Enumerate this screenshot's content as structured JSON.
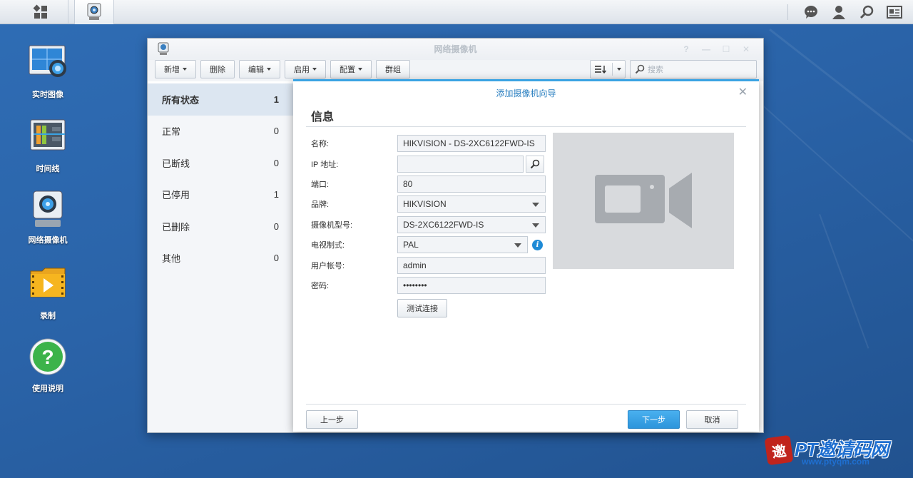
{
  "desktop": {
    "icons": [
      {
        "label": "实时图像",
        "icon": "live-view-icon"
      },
      {
        "label": "时间线",
        "icon": "timeline-icon"
      },
      {
        "label": "网络摄像机",
        "icon": "ip-camera-icon"
      },
      {
        "label": "录制",
        "icon": "recording-icon"
      },
      {
        "label": "使用说明",
        "icon": "help-icon"
      }
    ]
  },
  "window": {
    "title": "网络摄像机",
    "toolbar": {
      "add": "新增",
      "delete": "删除",
      "edit": "编辑",
      "enable": "启用",
      "config": "配置",
      "group": "群组",
      "search_placeholder": "搜索"
    },
    "sidebar": [
      {
        "label": "所有状态",
        "count": "1"
      },
      {
        "label": "正常",
        "count": "0"
      },
      {
        "label": "已断线",
        "count": "0"
      },
      {
        "label": "已停用",
        "count": "1"
      },
      {
        "label": "已删除",
        "count": "0"
      },
      {
        "label": "其他",
        "count": "0"
      }
    ]
  },
  "wizard": {
    "title": "添加摄像机向导",
    "heading": "信息",
    "fields": {
      "name_label": "名称:",
      "name_value": "HIKVISION - DS-2XC6122FWD-IS",
      "ip_label": "IP 地址:",
      "ip_value": "",
      "port_label": "端口:",
      "port_value": "80",
      "brand_label": "品牌:",
      "brand_value": "HIKVISION",
      "model_label": "摄像机型号:",
      "model_value": "DS-2XC6122FWD-IS",
      "tv_label": "电视制式:",
      "tv_value": "PAL",
      "user_label": "用户帐号:",
      "user_value": "admin",
      "password_label": "密码:",
      "password_value": "••••••••"
    },
    "test_button": "测试连接",
    "prev_button": "上一步",
    "next_button": "下一步",
    "cancel_button": "取消"
  },
  "watermark": {
    "seal": "邀",
    "text": "PT邀请码网",
    "url": "www.ptyqm.com"
  },
  "colors": {
    "accent": "#3aa3e3",
    "desktop_bg": "#2a63a8"
  }
}
